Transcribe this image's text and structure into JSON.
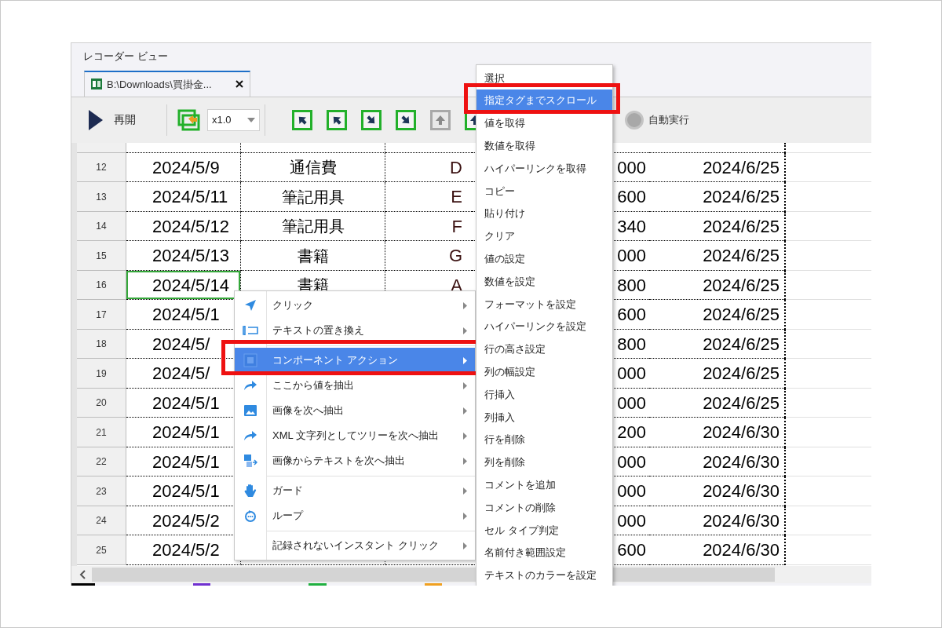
{
  "panel": {
    "title": "レコーダー ビュー"
  },
  "tabs": [
    {
      "label": "B:\\Downloads\\買掛金...",
      "selected": true
    }
  ],
  "toolbar": {
    "resume": "再開",
    "speed": "x1.0",
    "nav_buttons": [
      {
        "disabled": false
      },
      {
        "disabled": false
      },
      {
        "disabled": false
      },
      {
        "disabled": false
      },
      {
        "disabled": true
      },
      {
        "disabled": false
      }
    ],
    "auto_run": {
      "label": "自動実行",
      "disabled": true
    }
  },
  "sheet": {
    "rows": [
      {
        "number": "12",
        "column_1": {
          "text": "2024/5/9",
          "selected": false
        },
        "column_2": {
          "text": "通信費",
          "selected": false
        },
        "column_3": {
          "text": "D",
          "selected": false
        },
        "column_4": {
          "text": "000",
          "selected": false
        },
        "column_5": {
          "text": "2024/6/25",
          "selected": false
        }
      },
      {
        "number": "13",
        "column_1": {
          "text": "2024/5/11",
          "selected": false
        },
        "column_2": {
          "text": "筆記用具",
          "selected": false
        },
        "column_3": {
          "text": "E",
          "selected": false
        },
        "column_4": {
          "text": "600",
          "selected": false
        },
        "column_5": {
          "text": "2024/6/25",
          "selected": false
        }
      },
      {
        "number": "14",
        "column_1": {
          "text": "2024/5/12",
          "selected": false
        },
        "column_2": {
          "text": "筆記用具",
          "selected": false
        },
        "column_3": {
          "text": "F",
          "selected": false
        },
        "column_4": {
          "text": "340",
          "selected": false
        },
        "column_5": {
          "text": "2024/6/25",
          "selected": false
        }
      },
      {
        "number": "15",
        "column_1": {
          "text": "2024/5/13",
          "selected": false
        },
        "column_2": {
          "text": "書籍",
          "selected": false
        },
        "column_3": {
          "text": "G",
          "selected": false
        },
        "column_4": {
          "text": "000",
          "selected": false
        },
        "column_5": {
          "text": "2024/6/25",
          "selected": false
        }
      },
      {
        "number": "16",
        "column_1": {
          "text": "2024/5/14",
          "selected": true
        },
        "column_2": {
          "text": "書籍",
          "selected": false
        },
        "column_3": {
          "text": "A",
          "selected": false
        },
        "column_4": {
          "text": "800",
          "selected": false
        },
        "column_5": {
          "text": "2024/6/25",
          "selected": false
        }
      },
      {
        "number": "17",
        "column_1": {
          "text": "2024/5/1",
          "selected": false
        },
        "column_4": {
          "text": "600",
          "selected": false
        },
        "column_5": {
          "text": "2024/6/25",
          "selected": false
        }
      },
      {
        "number": "18",
        "column_1": {
          "text": "2024/5/",
          "selected": false
        },
        "column_4": {
          "text": "800",
          "selected": false
        },
        "column_5": {
          "text": "2024/6/25",
          "selected": false
        }
      },
      {
        "number": "19",
        "column_1": {
          "text": "2024/5/",
          "selected": false
        },
        "column_4": {
          "text": "000",
          "selected": false
        },
        "column_5": {
          "text": "2024/6/25",
          "selected": false
        }
      },
      {
        "number": "20",
        "column_1": {
          "text": "2024/5/1",
          "selected": false
        },
        "column_4": {
          "text": "000",
          "selected": false
        },
        "column_5": {
          "text": "2024/6/25",
          "selected": false
        }
      },
      {
        "number": "21",
        "column_1": {
          "text": "2024/5/1",
          "selected": false
        },
        "column_4": {
          "text": "200",
          "selected": false
        },
        "column_5": {
          "text": "2024/6/30",
          "selected": false
        }
      },
      {
        "number": "22",
        "column_1": {
          "text": "2024/5/1",
          "selected": false
        },
        "column_4": {
          "text": "000",
          "selected": false
        },
        "column_5": {
          "text": "2024/6/30",
          "selected": false
        }
      },
      {
        "number": "23",
        "column_1": {
          "text": "2024/5/1",
          "selected": false
        },
        "column_4": {
          "text": "000",
          "selected": false
        },
        "column_5": {
          "text": "2024/6/30",
          "selected": false
        }
      },
      {
        "number": "24",
        "column_1": {
          "text": "2024/5/2",
          "selected": false
        },
        "column_4": {
          "text": "000",
          "selected": false
        },
        "column_5": {
          "text": "2024/6/30",
          "selected": false
        }
      },
      {
        "number": "25",
        "column_1": {
          "text": "2024/5/2",
          "selected": false
        },
        "column_4": {
          "text": "600",
          "selected": false
        },
        "column_5": {
          "text": "2024/6/30",
          "selected": false
        }
      }
    ]
  },
  "context_menu": {
    "items": [
      {
        "kind": "item",
        "label": "クリック",
        "selected": false
      },
      {
        "kind": "item",
        "label": "テキストの置き換え",
        "selected": false
      },
      {
        "kind": "separator"
      },
      {
        "kind": "item",
        "label": "コンポーネント アクション",
        "selected": true
      },
      {
        "kind": "item",
        "label": "ここから値を抽出",
        "selected": false
      },
      {
        "kind": "item",
        "label": "画像を次へ抽出",
        "selected": false
      },
      {
        "kind": "item",
        "label": "XML 文字列としてツリーを次へ抽出",
        "selected": false
      },
      {
        "kind": "item",
        "label": "画像からテキストを次へ抽出",
        "selected": false
      },
      {
        "kind": "separator"
      },
      {
        "kind": "item",
        "label": "ガード",
        "selected": false
      },
      {
        "kind": "item",
        "label": "ループ",
        "selected": false
      },
      {
        "kind": "separator"
      },
      {
        "kind": "item",
        "label": "記録されないインスタント クリック",
        "selected": false
      }
    ]
  },
  "submenu": {
    "items": [
      {
        "label": "選択",
        "selected": false
      },
      {
        "label": "指定タグまでスクロール",
        "selected": true
      },
      {
        "label": "値を取得",
        "selected": false
      },
      {
        "label": "数値を取得",
        "selected": false
      },
      {
        "label": "ハイパーリンクを取得",
        "selected": false
      },
      {
        "label": "コピー",
        "selected": false
      },
      {
        "label": "貼り付け",
        "selected": false
      },
      {
        "label": "クリア",
        "selected": false
      },
      {
        "label": "値の設定",
        "selected": false
      },
      {
        "label": "数値を設定",
        "selected": false
      },
      {
        "label": "フォーマットを設定",
        "selected": false
      },
      {
        "label": "ハイパーリンクを設定",
        "selected": false
      },
      {
        "label": "行の高さ設定",
        "selected": false
      },
      {
        "label": "列の幅設定",
        "selected": false
      },
      {
        "label": "行挿入",
        "selected": false
      },
      {
        "label": "列挿入",
        "selected": false
      },
      {
        "label": "行を削除",
        "selected": false
      },
      {
        "label": "列を削除",
        "selected": false
      },
      {
        "label": "コメントを追加",
        "selected": false
      },
      {
        "label": "コメントの削除",
        "selected": false
      },
      {
        "label": "セル タイプ判定",
        "selected": false
      },
      {
        "label": "名前付き範囲設定",
        "selected": false
      },
      {
        "label": "テキストのカラーを設定",
        "selected": false
      }
    ]
  }
}
